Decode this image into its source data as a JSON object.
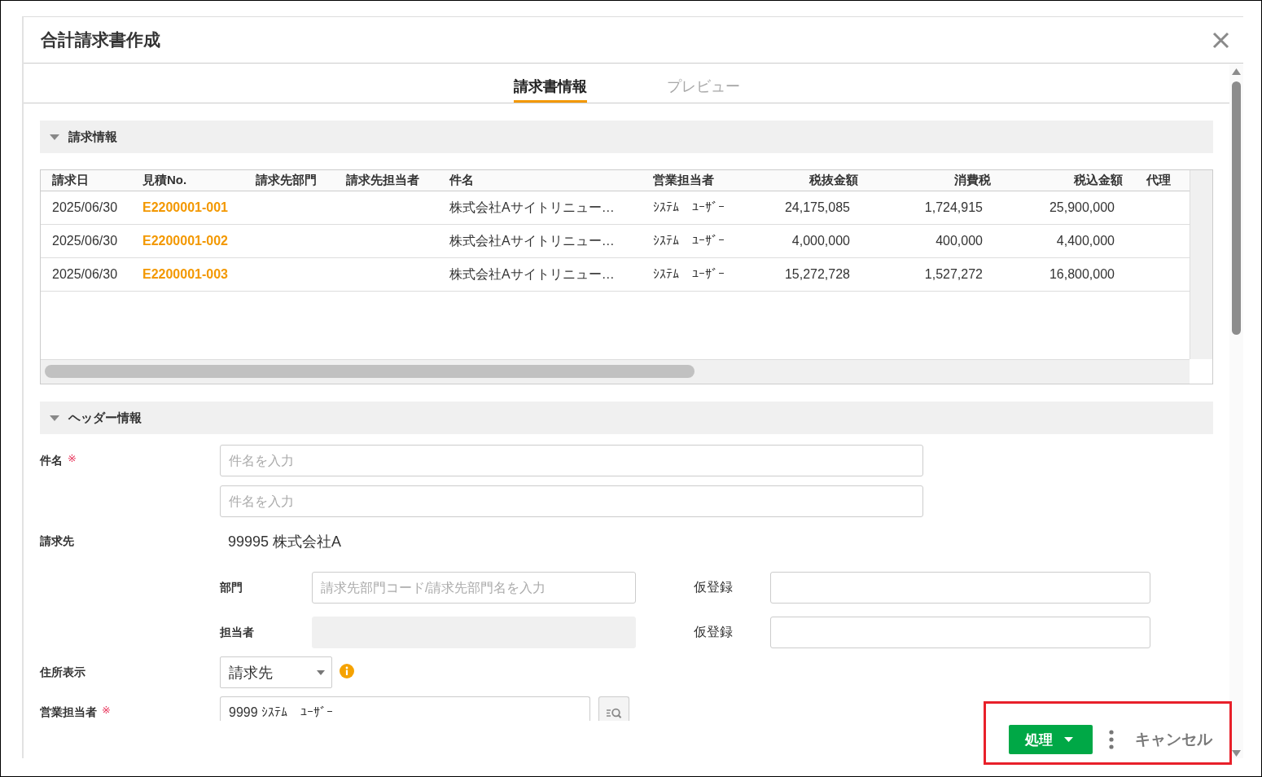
{
  "dialog": {
    "title": "合計請求書作成"
  },
  "tabs": [
    {
      "label": "請求書情報",
      "selected": true
    },
    {
      "label": "プレビュー",
      "selected": false
    }
  ],
  "invoice_section": {
    "title": "請求情報",
    "expanded": true,
    "table": {
      "columns": [
        {
          "label": "請求日",
          "kind": "text"
        },
        {
          "label": "見積No.",
          "kind": "link"
        },
        {
          "label": "請求先部門",
          "kind": "text"
        },
        {
          "label": "請求先担当者",
          "kind": "text"
        },
        {
          "label": "件名",
          "kind": "text"
        },
        {
          "label": "営業担当者",
          "kind": "text"
        },
        {
          "label": "税抜金額",
          "kind": "amount"
        },
        {
          "label": "消費税",
          "kind": "amount"
        },
        {
          "label": "税込金額",
          "kind": "amount"
        },
        {
          "label": "代理",
          "kind": "text"
        }
      ],
      "rows": [
        {
          "billing_date": "2025/06/30",
          "estimate_no": "E2200001-001",
          "subject": "株式会社Aサイトリニュー…",
          "sales_rep": "ｼｽﾃﾑ　ﾕｰｻﾞｰ",
          "amount_excl_tax": "24,175,085",
          "tax": "1,724,915",
          "amount_incl_tax": "25,900,000"
        },
        {
          "billing_date": "2025/06/30",
          "estimate_no": "E2200001-002",
          "subject": "株式会社Aサイトリニュー…",
          "sales_rep": "ｼｽﾃﾑ　ﾕｰｻﾞｰ",
          "amount_excl_tax": "4,000,000",
          "tax": "400,000",
          "amount_incl_tax": "4,400,000"
        },
        {
          "billing_date": "2025/06/30",
          "estimate_no": "E2200001-003",
          "subject": "株式会社Aサイトリニュー…",
          "sales_rep": "ｼｽﾃﾑ　ﾕｰｻﾞｰ",
          "amount_excl_tax": "15,272,728",
          "tax": "1,527,272",
          "amount_incl_tax": "16,800,000"
        }
      ]
    }
  },
  "header_section": {
    "title": "ヘッダー情報",
    "expanded": true,
    "fields": [
      {
        "kind": "inputs",
        "label": "件名",
        "required_mark": "※",
        "inputs": [
          {
            "placeholder": "件名を入力"
          },
          {
            "placeholder": "件名を入力"
          }
        ]
      },
      {
        "kind": "client",
        "label": "請求先",
        "value": "99995 株式会社A",
        "sub_fields": [
          {
            "label": "部門",
            "placeholder": "請求先部門コード/請求先部門名を入力",
            "disabled": false,
            "side_label": "仮登録"
          },
          {
            "label": "担当者",
            "disabled": true,
            "side_label": "仮登録"
          }
        ]
      },
      {
        "kind": "select",
        "label": "住所表示",
        "value": "請求先"
      },
      {
        "kind": "lookup",
        "label": "営業担当者",
        "required_mark": "※",
        "value": "9999 ｼｽﾃﾑ　ﾕｰｻﾞｰ"
      }
    ]
  },
  "footer": {
    "buttons": [
      {
        "kind": "primary",
        "label": "処理"
      },
      {
        "kind": "more"
      },
      {
        "kind": "link",
        "label": "キャンセル"
      }
    ]
  }
}
